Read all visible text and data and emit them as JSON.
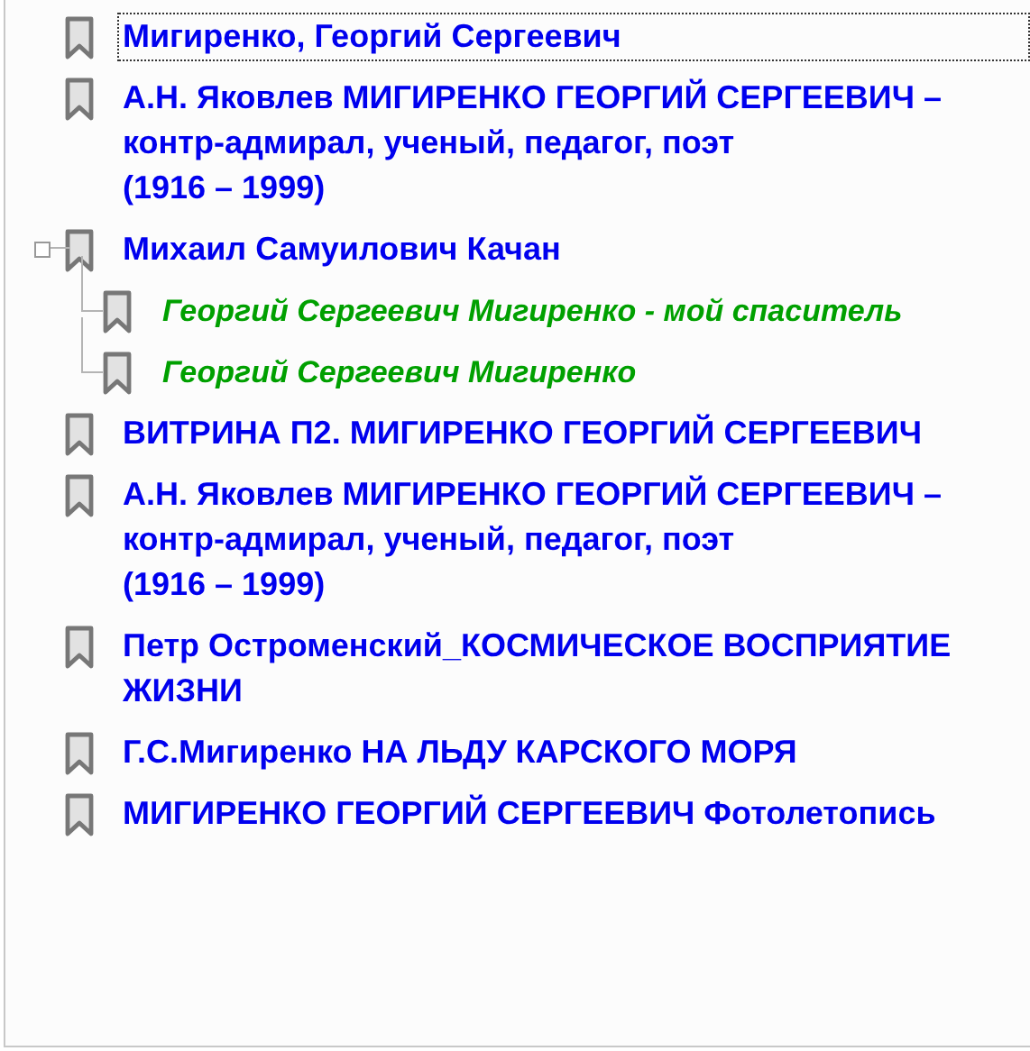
{
  "bookmarks": [
    {
      "text": "Мигиренко, Георгий Сергеевич",
      "color": "#0000ee",
      "selected": true
    },
    {
      "text": "А.Н. Яковлев МИГИРЕНКО ГЕОРГИЙ СЕРГЕЕВИЧ – контр-адмирал, ученый, педагог, поэт\n(1916 – 1999)",
      "color": "#0000ee",
      "selected": false
    },
    {
      "text": "Михаил Самуилович Качан",
      "color": "#0000ee",
      "selected": false,
      "expanded": true,
      "children": [
        {
          "text": "Георгий Сергеевич Мигиренко - мой спаситель",
          "color": "#00a000",
          "selected": false
        },
        {
          "text": "Георгий Сергеевич Мигиренко",
          "color": "#00a000",
          "selected": false
        }
      ]
    },
    {
      "text": "ВИТРИНА П2. МИГИРЕНКО ГЕОРГИЙ СЕРГЕЕВИЧ",
      "color": "#0000ee",
      "selected": false
    },
    {
      "text": "А.Н. Яковлев МИГИРЕНКО ГЕОРГИЙ СЕРГЕЕВИЧ – контр-адмирал, ученый, педагог, поэт\n(1916 – 1999)",
      "color": "#0000ee",
      "selected": false
    },
    {
      "text": "Петр Остроменский_КОСМИЧЕСКОЕ ВОСПРИЯТИЕ ЖИЗНИ",
      "color": "#0000ee",
      "selected": false
    },
    {
      "text": "Г.С.Мигиренко НА ЛЬДУ КАРСКОГО МОРЯ",
      "color": "#0000ee",
      "selected": false
    },
    {
      "text": "МИГИРЕНКО ГЕОРГИЙ СЕРГЕЕВИЧ Фотолетопись",
      "color": "#0000ee",
      "selected": false
    }
  ]
}
